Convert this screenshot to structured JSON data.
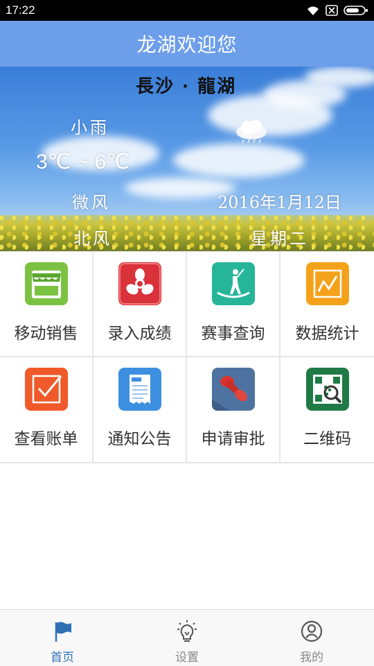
{
  "status_bar": {
    "time": "17:22",
    "icons": [
      "wifi-icon",
      "no-sim-icon",
      "battery-icon"
    ]
  },
  "header": {
    "title": "龙湖欢迎您"
  },
  "weather": {
    "location": "長沙 · 龍湖",
    "condition": "小雨",
    "temperature": "3℃ ~ 6℃",
    "wind_level": "微风",
    "date": "2016年1月12日",
    "wind_direction": "北风",
    "weekday": "星期二",
    "icon": "cloud-rain-icon"
  },
  "menu": {
    "items": [
      {
        "label": "移动销售",
        "icon": "store-icon",
        "color": "#7cc242"
      },
      {
        "label": "录入成绩",
        "icon": "air-icon",
        "color": "#d9323a"
      },
      {
        "label": "赛事查询",
        "icon": "golfer-icon",
        "color": "#27b59a"
      },
      {
        "label": "数据统计",
        "icon": "chart-icon",
        "color": "#f5a21b"
      },
      {
        "label": "查看账单",
        "icon": "checkbox-icon",
        "color": "#f05a2a"
      },
      {
        "label": "通知公告",
        "icon": "news-icon",
        "color": "#3d8fe0"
      },
      {
        "label": "申请审批",
        "icon": "stamp-icon",
        "color": "#4f73a0"
      },
      {
        "label": "二维码",
        "icon": "qrcode-icon",
        "color": "#1f7a45"
      }
    ]
  },
  "bottom_nav": {
    "items": [
      {
        "label": "首页",
        "icon": "flag-icon",
        "active": true
      },
      {
        "label": "设置",
        "icon": "lightbulb-icon",
        "active": false
      },
      {
        "label": "我的",
        "icon": "user-icon",
        "active": false
      }
    ],
    "active_color": "#2f6fb3"
  },
  "colors": {
    "title_bar": "#6d9eea",
    "status_bar": "#000000"
  }
}
